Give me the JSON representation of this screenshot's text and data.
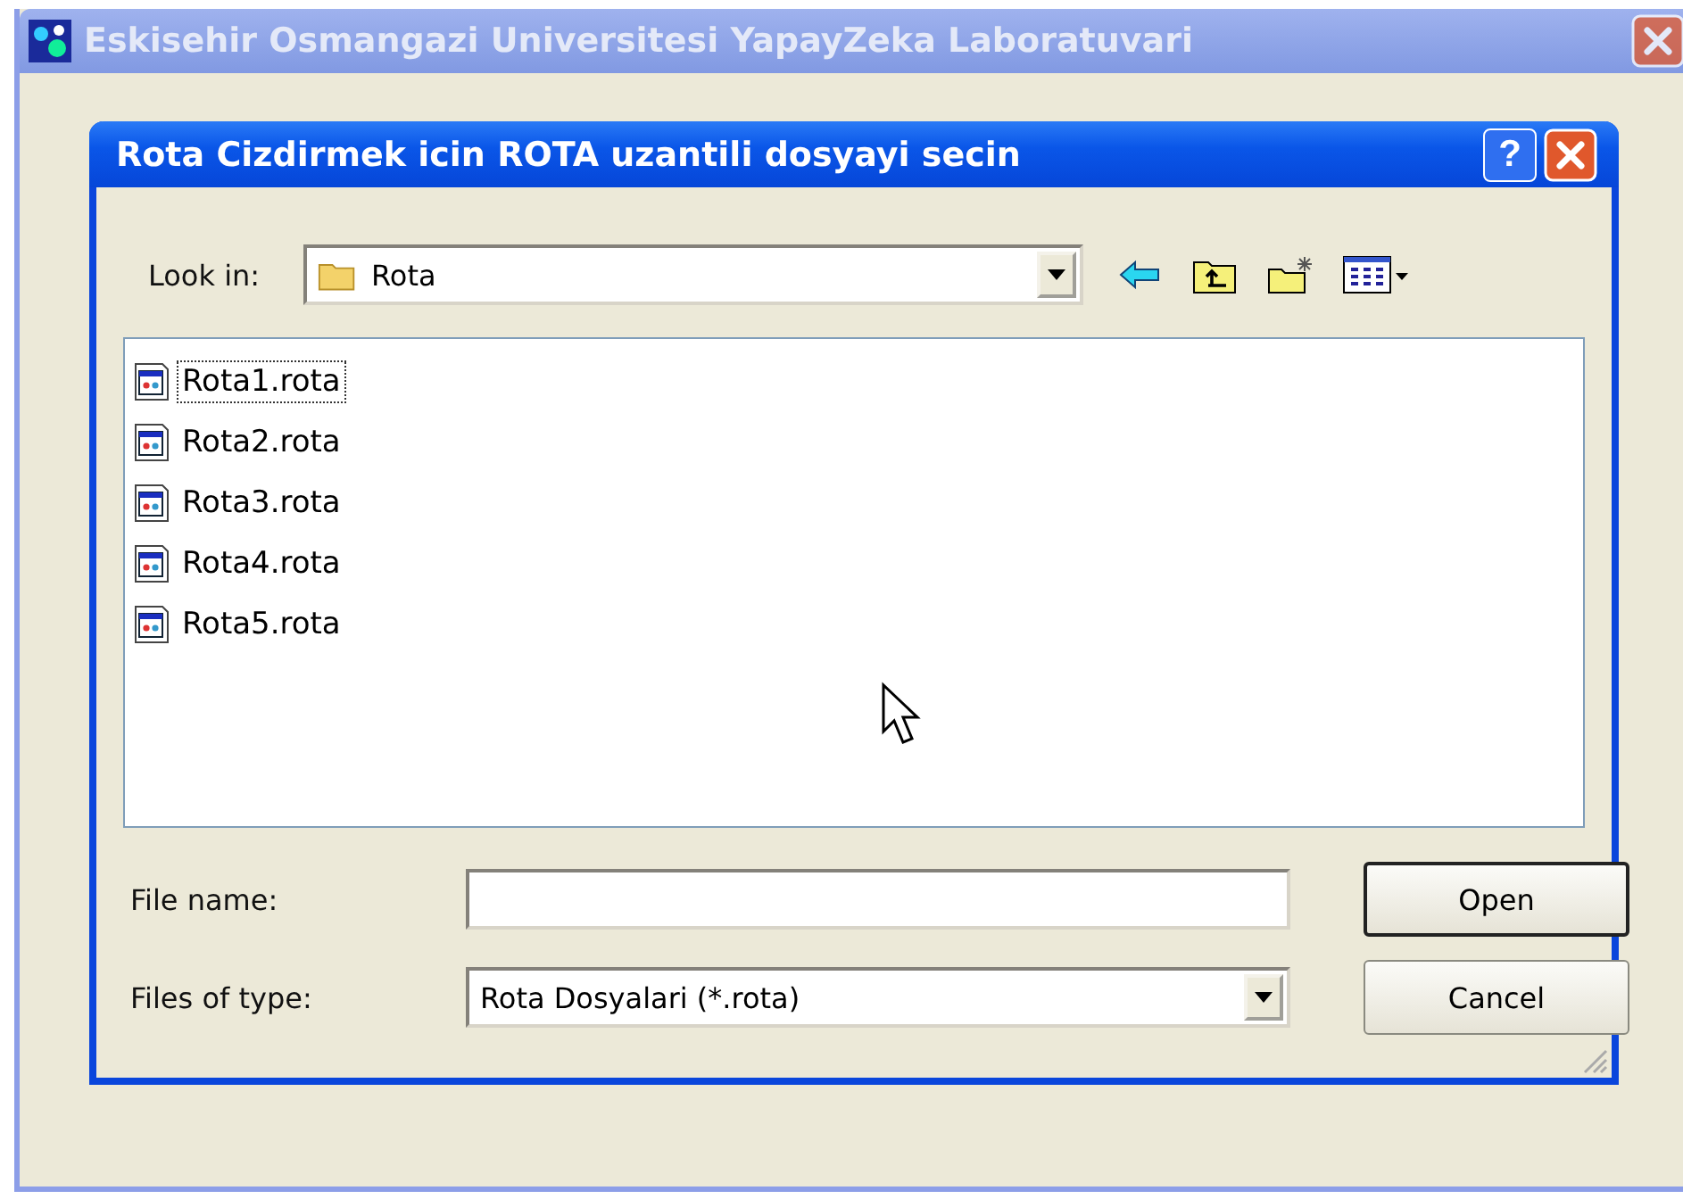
{
  "main_window": {
    "title": "Eskisehir Osmangazi Universitesi YapayZeka Laboratuvari"
  },
  "dialog": {
    "title": "Rota Cizdirmek icin ROTA uzantili dosyayi secin",
    "help_button": "?",
    "look_in": {
      "label": "Look in:",
      "value": "Rota"
    },
    "files": [
      {
        "name": "Rota1.rota",
        "focused": true
      },
      {
        "name": "Rota2.rota",
        "focused": false
      },
      {
        "name": "Rota3.rota",
        "focused": false
      },
      {
        "name": "Rota4.rota",
        "focused": false
      },
      {
        "name": "Rota5.rota",
        "focused": false
      }
    ],
    "file_name": {
      "label": "File name:"
    },
    "file_type": {
      "label": "Files of type:",
      "value": "Rota Dosyalari (*.rota)"
    },
    "buttons": [
      {
        "label": "Open",
        "default": true
      },
      {
        "label": "Cancel",
        "default": false
      }
    ]
  }
}
